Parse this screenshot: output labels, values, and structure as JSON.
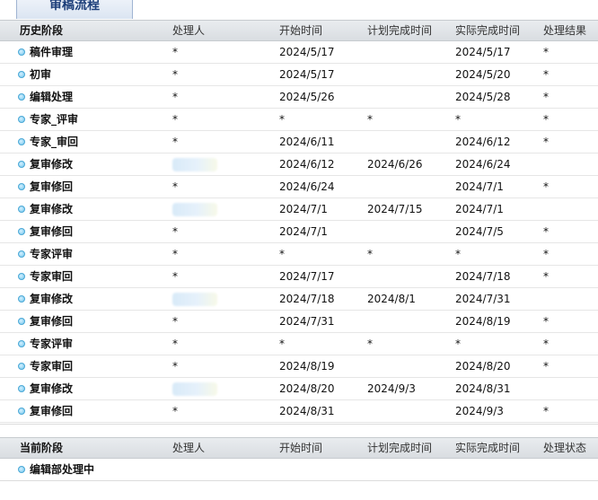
{
  "tab": {
    "label": "审稿流程"
  },
  "history": {
    "headers": {
      "stage": "历史阶段",
      "handler": "处理人",
      "start": "开始时间",
      "plan": "计划完成时间",
      "actual": "实际完成时间",
      "result": "处理结果"
    },
    "rows": [
      {
        "stage": "稿件审理",
        "handler": "*",
        "start": "2024/5/17",
        "plan": "",
        "actual": "2024/5/17",
        "result": "*"
      },
      {
        "stage": "初审",
        "handler": "*",
        "start": "2024/5/17",
        "plan": "",
        "actual": "2024/5/20",
        "result": "*"
      },
      {
        "stage": "编辑处理",
        "handler": "*",
        "start": "2024/5/26",
        "plan": "",
        "actual": "2024/5/28",
        "result": "*"
      },
      {
        "stage": "专家_评审",
        "handler": "*",
        "start": "*",
        "plan": "*",
        "actual": "*",
        "result": "*"
      },
      {
        "stage": "专家_审回",
        "handler": "*",
        "start": "2024/6/11",
        "plan": "",
        "actual": "2024/6/12",
        "result": "*"
      },
      {
        "stage": "复审修改",
        "handler": "",
        "start": "2024/6/12",
        "plan": "2024/6/26",
        "actual": "2024/6/24",
        "result": ""
      },
      {
        "stage": "复审修回",
        "handler": "*",
        "start": "2024/6/24",
        "plan": "",
        "actual": "2024/7/1",
        "result": "*"
      },
      {
        "stage": "复审修改",
        "handler": "",
        "start": "2024/7/1",
        "plan": "2024/7/15",
        "actual": "2024/7/1",
        "result": ""
      },
      {
        "stage": "复审修回",
        "handler": "*",
        "start": "2024/7/1",
        "plan": "",
        "actual": "2024/7/5",
        "result": "*"
      },
      {
        "stage": "专家评审",
        "handler": "*",
        "start": "*",
        "plan": "*",
        "actual": "*",
        "result": "*"
      },
      {
        "stage": "专家审回",
        "handler": "*",
        "start": "2024/7/17",
        "plan": "",
        "actual": "2024/7/18",
        "result": "*"
      },
      {
        "stage": "复审修改",
        "handler": "",
        "start": "2024/7/18",
        "plan": "2024/8/1",
        "actual": "2024/7/31",
        "result": ""
      },
      {
        "stage": "复审修回",
        "handler": "*",
        "start": "2024/7/31",
        "plan": "",
        "actual": "2024/8/19",
        "result": "*"
      },
      {
        "stage": "专家评审",
        "handler": "*",
        "start": "*",
        "plan": "*",
        "actual": "*",
        "result": "*"
      },
      {
        "stage": "专家审回",
        "handler": "*",
        "start": "2024/8/19",
        "plan": "",
        "actual": "2024/8/20",
        "result": "*"
      },
      {
        "stage": "复审修改",
        "handler": "",
        "start": "2024/8/20",
        "plan": "2024/9/3",
        "actual": "2024/8/31",
        "result": ""
      },
      {
        "stage": "复审修回",
        "handler": "*",
        "start": "2024/8/31",
        "plan": "",
        "actual": "2024/9/3",
        "result": "*"
      }
    ]
  },
  "current": {
    "headers": {
      "stage": "当前阶段",
      "handler": "处理人",
      "start": "开始时间",
      "plan": "计划完成时间",
      "actual": "实际完成时间",
      "status": "处理状态"
    },
    "rows": [
      {
        "stage": "编辑部处理中",
        "handler": "",
        "start": "",
        "plan": "",
        "actual": "",
        "status": ""
      }
    ]
  }
}
